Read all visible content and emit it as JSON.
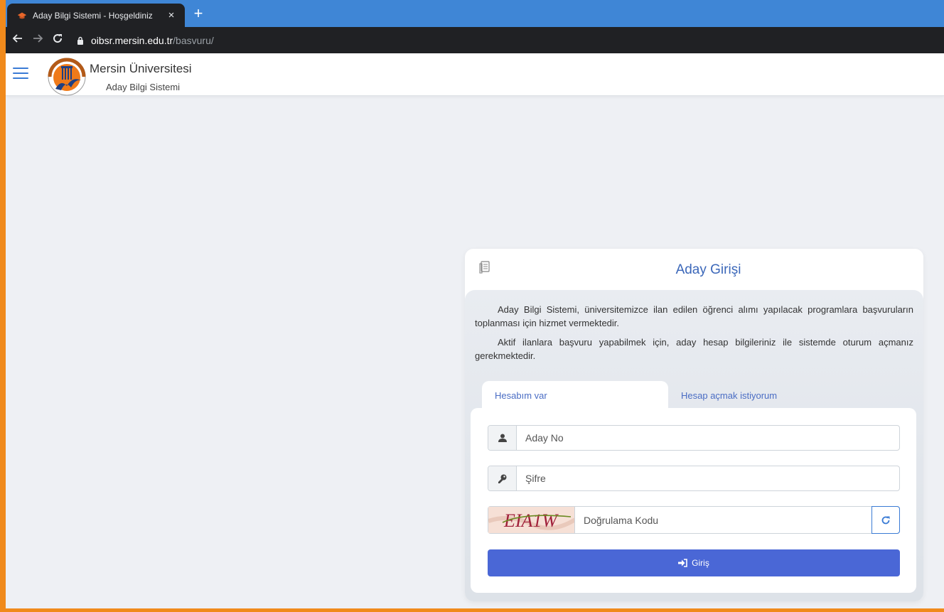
{
  "browser": {
    "tab_title": "Aday Bilgi Sistemi - Hoşgeldiniz",
    "tab_close": "×",
    "new_tab": "+",
    "url_host": "oibsr.mersin.edu.tr",
    "url_path": "/basvuru/"
  },
  "header": {
    "title": "Mersin Üniversitesi",
    "subtitle": "Aday Bilgi Sistemi"
  },
  "login": {
    "title": "Aday Girişi",
    "description_1": "Aday Bilgi Sistemi, üniversitemizce ilan edilen öğrenci alımı yapılacak programlara başvuruların toplanması için hizmet vermektedir.",
    "description_2": "Aktif ilanlara başvuru yapabilmek için, aday hesap bilgileriniz ile sistemde oturum açmanız gerekmektedir.",
    "tabs": [
      {
        "label": "Hesabım var",
        "active": true
      },
      {
        "label": "Hesap açmak istiyorum",
        "active": false
      }
    ],
    "candidate_no_placeholder": "Aday No",
    "password_placeholder": "Şifre",
    "captcha_placeholder": "Doğrulama Kodu",
    "captcha_text": "EIA1W",
    "submit_label": "Giriş"
  },
  "colors": {
    "accent": "#4a67d6",
    "frame": "#f08a1c",
    "tabstrip": "#3f86d6"
  }
}
